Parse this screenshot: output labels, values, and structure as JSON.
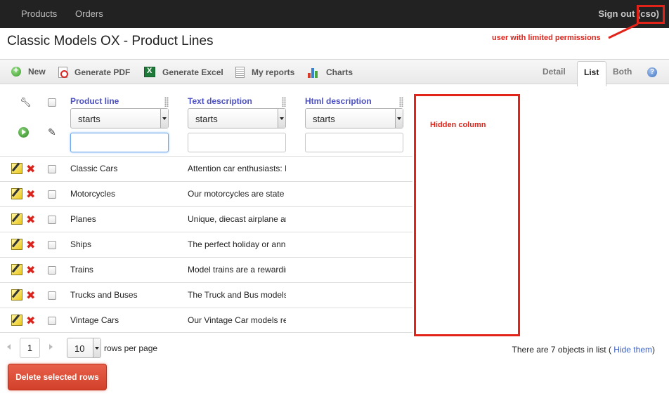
{
  "nav": {
    "products": "Products",
    "orders": "Orders",
    "sign_out": "Sign out (cso)"
  },
  "annotations": {
    "user_note": "user with limited permissions",
    "hidden_column": "Hidden column"
  },
  "page": {
    "title": "Classic Models OX - Product Lines"
  },
  "toolbar": {
    "new": "New",
    "generate_pdf": "Generate PDF",
    "generate_excel": "Generate Excel",
    "my_reports": "My reports",
    "charts": "Charts"
  },
  "views": {
    "detail": "Detail",
    "list": "List",
    "both": "Both"
  },
  "columns": [
    {
      "label": "Product line",
      "filter_mode": "starts"
    },
    {
      "label": "Text description",
      "filter_mode": "starts"
    },
    {
      "label": "Html description",
      "filter_mode": "starts"
    }
  ],
  "rows": [
    {
      "product_line": "Classic Cars",
      "text_description": "Attention car enthusiasts: M"
    },
    {
      "product_line": "Motorcycles",
      "text_description": "Our motorcycles are state of"
    },
    {
      "product_line": "Planes",
      "text_description": "Unique, diecast airplane and"
    },
    {
      "product_line": "Ships",
      "text_description": "The perfect holiday or anniv"
    },
    {
      "product_line": "Trains",
      "text_description": "Model trains are a rewarding"
    },
    {
      "product_line": "Trucks and Buses",
      "text_description": "The Truck and Bus models are"
    },
    {
      "product_line": "Vintage Cars",
      "text_description": "Our Vintage Car models reali"
    }
  ],
  "footer": {
    "current_page": "1",
    "rows_per_page": "10",
    "rows_per_page_label": "rows per page",
    "count_text": "There are 7 objects in list (",
    "hide_link": "Hide them",
    "close_paren": ")",
    "delete_selected": "Delete selected rows"
  },
  "colors": {
    "annotation_red": "#e2231a",
    "header_link": "#4a4fc4",
    "delete_button": "#d2402a"
  }
}
